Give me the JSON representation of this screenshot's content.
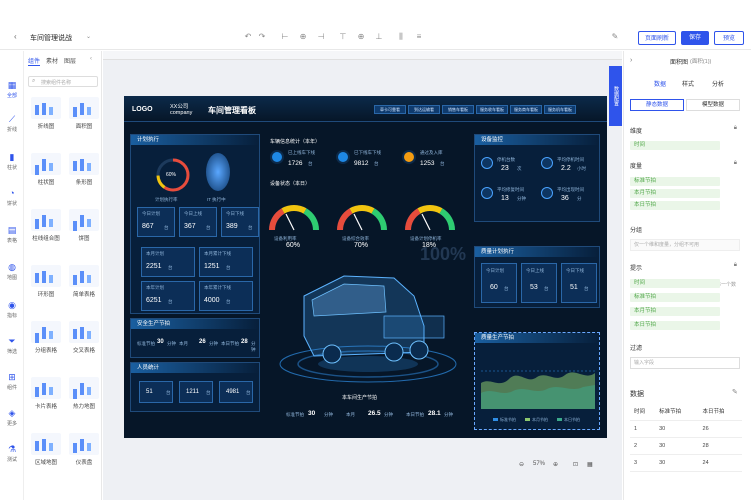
{
  "topbar": {
    "title": "车间管理说战",
    "back_icon": "chevron-left-icon",
    "dropdown_icon": "chevron-down-icon",
    "buttons": {
      "refresh": "页面刷新",
      "save": "保存",
      "preview": "预览"
    }
  },
  "sidebar": {
    "tabs": [
      "组件",
      "素材",
      "图层"
    ],
    "search_placeholder": "搜索组件名称",
    "rail": [
      {
        "label": "全部",
        "icon": "grid-icon"
      },
      {
        "label": "折线",
        "icon": "line-chart-icon"
      },
      {
        "label": "柱状",
        "icon": "bar-chart-icon"
      },
      {
        "label": "饼状",
        "icon": "pie-chart-icon"
      },
      {
        "label": "表格",
        "icon": "table-icon"
      },
      {
        "label": "地图",
        "icon": "globe-icon"
      },
      {
        "label": "指标",
        "icon": "indicator-icon"
      },
      {
        "label": "筛选",
        "icon": "filter-icon"
      },
      {
        "label": "组件",
        "icon": "component-icon"
      },
      {
        "label": "更多",
        "icon": "cube-icon"
      },
      {
        "label": "测试",
        "icon": "test-icon"
      }
    ],
    "components": [
      "折线图",
      "面积图",
      "柱状图",
      "条形图",
      "柱线组合图",
      "饼图",
      "环形图",
      "简单表格",
      "分组表格",
      "交叉表格",
      "卡片表格",
      "热力地图",
      "区域地图",
      "仪表盘"
    ]
  },
  "canvas": {
    "watermark": "100%",
    "zoom": "57%"
  },
  "dashboard": {
    "logo": "LOGO",
    "company_cn": "XX公司",
    "company_en": "company",
    "title": "车间管理看板",
    "nav": [
      "車卡可靠看",
      "到达运输看",
      "销售车看板",
      "服务收车看板",
      "服务商车看板",
      "服务机车看板"
    ],
    "plan": {
      "title": "计划执行",
      "gauge_pct": "60%",
      "gauge_label": "计划执行率",
      "vehicle_label": "IT 执行中",
      "row1": [
        {
          "label": "今日计划",
          "value": "867",
          "unit": "台"
        },
        {
          "label": "今日上线",
          "value": "367",
          "unit": "台"
        },
        {
          "label": "今日下线",
          "value": "389",
          "unit": "台"
        }
      ],
      "row2": [
        {
          "label": "本月计划",
          "value": "2251",
          "unit": "台"
        },
        {
          "label": "本月累计下线",
          "value": "1251",
          "unit": "台"
        }
      ],
      "row3": [
        {
          "label": "本年计划",
          "value": "6251",
          "unit": "台"
        },
        {
          "label": "本年累计下线",
          "value": "4000",
          "unit": "台"
        }
      ]
    },
    "energy_left": {
      "title": "安全生产节拍",
      "items": [
        {
          "label": "标准节拍",
          "value": "30",
          "unit": "分钟"
        },
        {
          "label": "本月",
          "value": "26",
          "unit": "分钟"
        },
        {
          "label": "本日节拍",
          "value": "28",
          "unit": "分钟"
        }
      ]
    },
    "people": {
      "title": "人员统计",
      "values": [
        "51",
        "1211",
        "4981"
      ],
      "units": [
        "台",
        "台",
        "台"
      ]
    },
    "center": {
      "stat_title": "车辆信息统计（本年）",
      "stat_head": "设备状态（本日）",
      "stats": [
        {
          "label": "已上线车下线",
          "value": "1726",
          "unit": "台"
        },
        {
          "label": "已下线车下线",
          "value": "9812",
          "unit": "台"
        },
        {
          "label": "通过及入库",
          "value": "1253",
          "unit": "台"
        }
      ],
      "gauges": [
        {
          "label": "设备利用率",
          "value": "60%"
        },
        {
          "label": "设备综合效率",
          "value": "70%"
        },
        {
          "label": "设备计划停机率",
          "value": "18%"
        }
      ],
      "bottom_title": "本车间生产节拍",
      "bottom": [
        {
          "label": "标准节拍",
          "value": "30",
          "unit": "分钟"
        },
        {
          "label": "本月",
          "value": "26.5",
          "unit": "分钟"
        },
        {
          "label": "本日节拍",
          "value": "28.1",
          "unit": "分钟"
        }
      ]
    },
    "equip": {
      "title": "设备监控",
      "items": [
        {
          "label": "停机台数",
          "value": "23",
          "unit": "次"
        },
        {
          "label": "平均停机时间",
          "value": "2.2",
          "unit": "小时"
        },
        {
          "label": "平均修复时间",
          "value": "13",
          "unit": "分钟"
        },
        {
          "label": "平均出现时间",
          "value": "36",
          "unit": "分"
        }
      ]
    },
    "quality": {
      "title": "质量计划执行",
      "items": [
        {
          "label": "今日计划",
          "value": "60",
          "unit": "台"
        },
        {
          "label": "今日上线",
          "value": "53",
          "unit": "台"
        },
        {
          "label": "今日下线",
          "value": "51",
          "unit": "台"
        }
      ]
    },
    "area": {
      "title": "质量生产节拍",
      "legend": [
        "标准节拍",
        "本月节拍",
        "本日节拍"
      ]
    }
  },
  "rightpanel": {
    "header": "面积图",
    "header_sub": "(面积(1))",
    "tabs": [
      "数据",
      "样式",
      "分析"
    ],
    "subtabs": [
      "静态数据",
      "模型数据"
    ],
    "dim_label": "维度",
    "dim_fields": [
      "时间"
    ],
    "measure_label": "度量",
    "measure_fields": [
      "标准节拍",
      "本月节拍",
      "本日节拍"
    ],
    "group_label": "分组",
    "group_placeholder": "仅一个维和度量，分组不可用",
    "tooltip_label": "提示",
    "tooltip_fields": [
      "时间",
      "标准节拍",
      "本月节拍",
      "本日节拍"
    ],
    "tooltip_extra": "每一个数",
    "filter_label": "过滤",
    "filter_placeholder": "输入字段",
    "data_title": "数据",
    "table": {
      "headers": [
        "时间",
        "标准节拍",
        "本日节拍"
      ],
      "rows": [
        [
          "1",
          "30",
          "26"
        ],
        [
          "2",
          "30",
          "28"
        ],
        [
          "3",
          "30",
          "24"
        ]
      ]
    }
  }
}
